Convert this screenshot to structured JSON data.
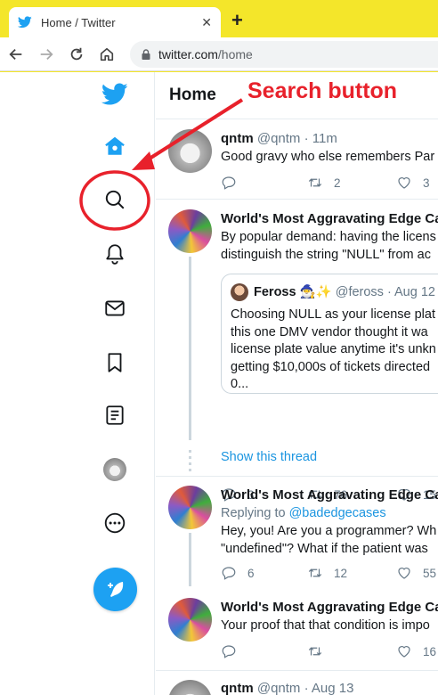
{
  "browser": {
    "tab_title": "Home / Twitter",
    "tab_close": "✕",
    "new_tab": "+",
    "url_host": "twitter.com",
    "url_path": "/home"
  },
  "feed": {
    "header": "Home",
    "tweets": [
      {
        "name": "qntm",
        "meta": "@qntm · 11m",
        "text": [
          "Good gravy who else remembers Par"
        ],
        "reply": "",
        "retweet": "2",
        "like": "3"
      },
      {
        "name": "World's Most Aggravating Edge Ca",
        "meta": "",
        "text": [
          "By popular demand: having the licens",
          "distinguish the string \"NULL\" from ac"
        ],
        "quote": {
          "name": "Feross 🧙‍♂️✨",
          "meta": "@feross · Aug 12",
          "text": [
            "Choosing NULL as your license plat",
            "this one DMV vendor thought it wa",
            "license plate value anytime it's unkn",
            "getting $10,000s of tickets directed",
            "0..."
          ]
        },
        "reply": "3",
        "retweet": "76",
        "like": "15"
      },
      {
        "show_thread": "Show this thread"
      },
      {
        "name": "World's Most Aggravating Edge Ca",
        "meta": "",
        "replying_prefix": "Replying to ",
        "replying_handle": "@badedgecases",
        "text": [
          "Hey, you! Are you a programmer? Wh",
          "\"undefined\"? What if the patient was"
        ],
        "reply": "6",
        "retweet": "12",
        "like": "55"
      },
      {
        "name": "World's Most Aggravating Edge Ca",
        "meta": "",
        "text": [
          "Your proof that that condition is impo"
        ],
        "reply": "",
        "retweet": "",
        "like": "16"
      },
      {
        "name": "qntm",
        "meta": "@qntm · Aug 13"
      }
    ]
  },
  "annotation": {
    "label": "Search button",
    "color": "#e8212b"
  },
  "colors": {
    "brand": "#1da1f2",
    "chrome": "#f4e62a",
    "link": "#1b95e0"
  }
}
